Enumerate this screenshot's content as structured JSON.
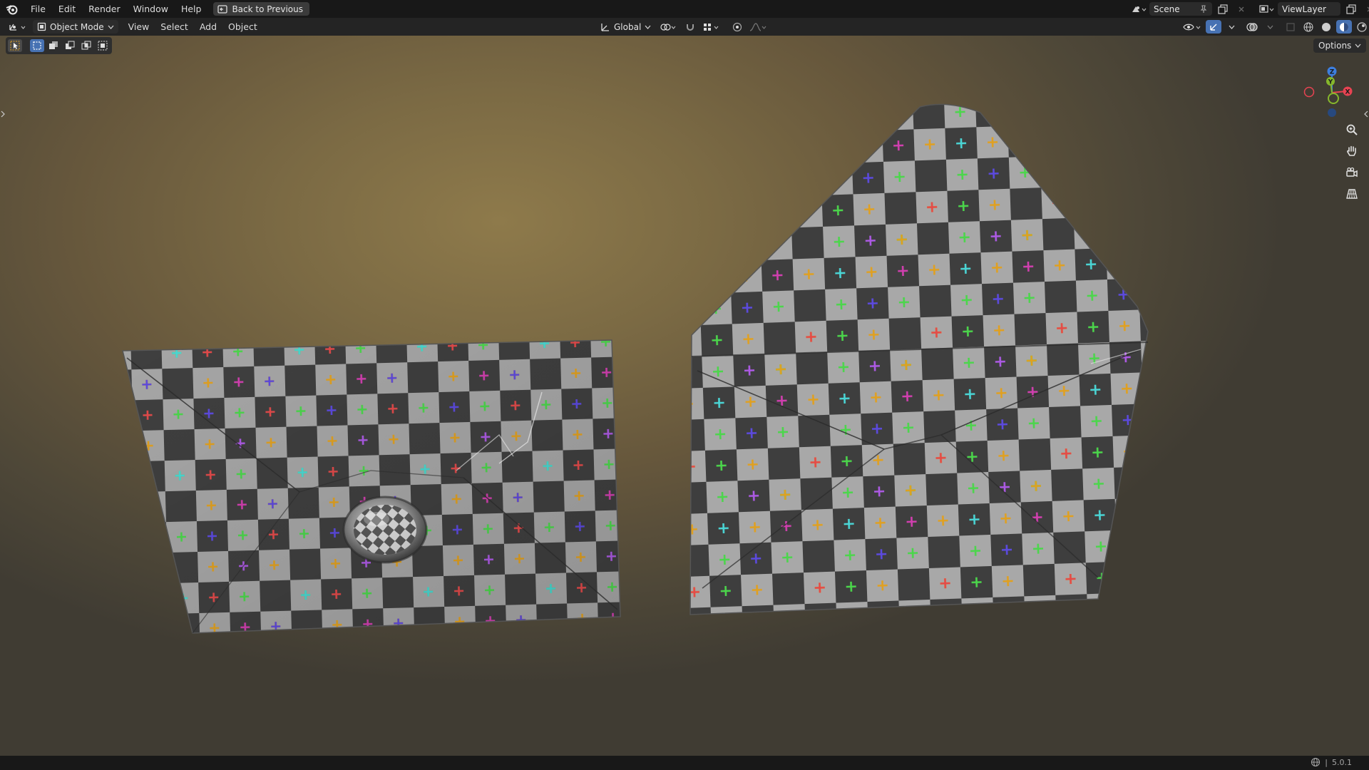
{
  "menu": {
    "items": [
      "File",
      "Edit",
      "Render",
      "Window",
      "Help"
    ],
    "back_button": "Back to Previous"
  },
  "scene": {
    "name": "Scene"
  },
  "view_layer": {
    "name": "ViewLayer"
  },
  "header": {
    "mode": "Object Mode",
    "menus": [
      "View",
      "Select",
      "Add",
      "Object"
    ],
    "transform_orientation": "Global"
  },
  "viewport": {
    "options_label": "Options",
    "gizmo_axes": [
      "X",
      "Y",
      "Z"
    ]
  },
  "status": {
    "version": "5.0.1"
  },
  "colors": {
    "accent": "#4772b3",
    "axis_x": "#e84352",
    "axis_y": "#86b72c",
    "axis_z": "#3d7fe0",
    "checker_light": "#a7a7a7",
    "checker_dark": "#3f3f3f",
    "cross_colors": [
      "#4bd64b",
      "#e0a020",
      "#e34a4a",
      "#5c4ae0",
      "#ad5ae5",
      "#4ad6d6",
      "#d23fb0"
    ]
  }
}
